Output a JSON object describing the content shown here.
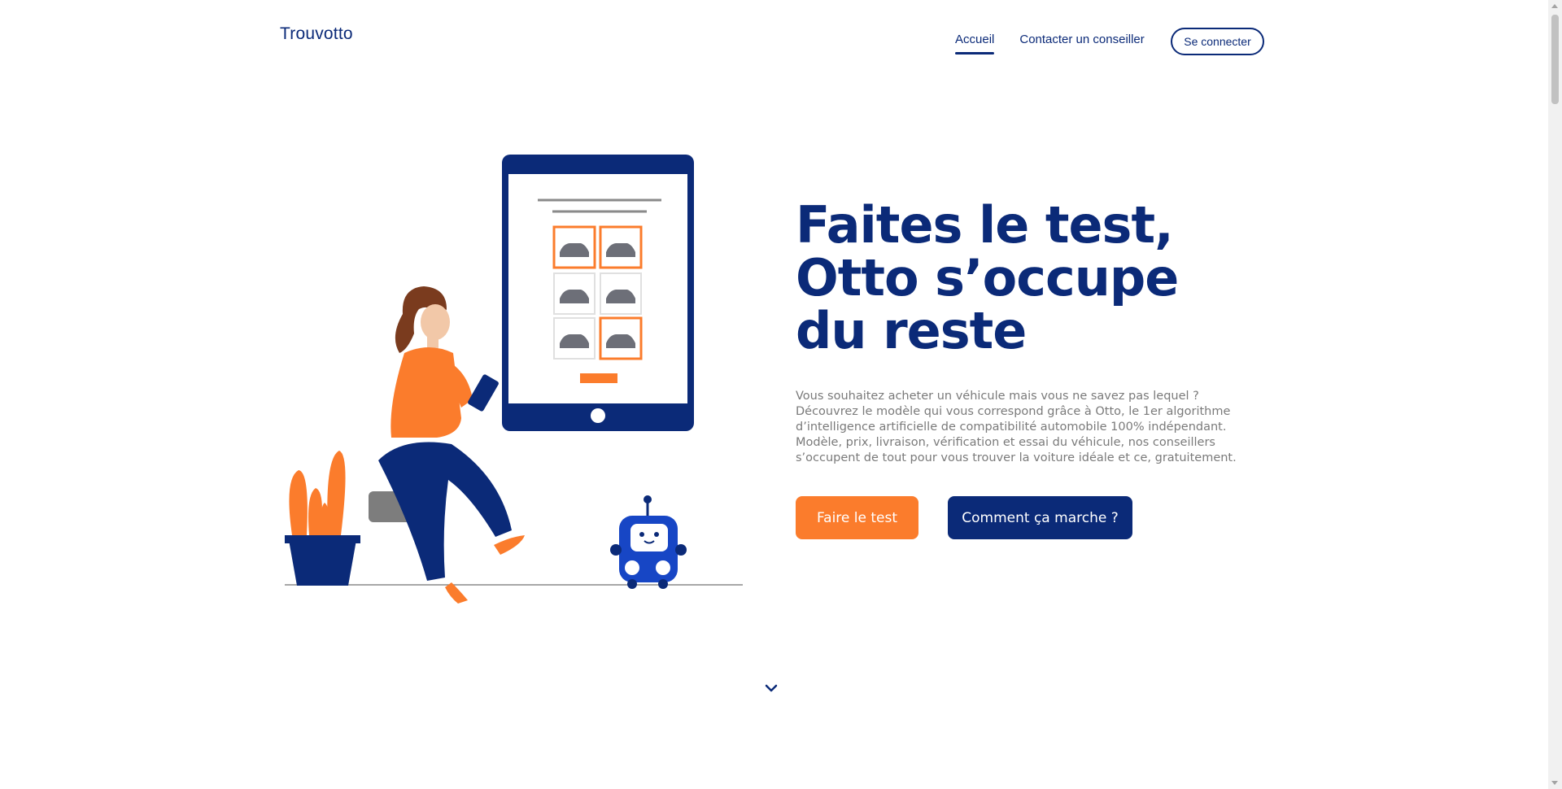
{
  "brand": {
    "name": "Trouvotto"
  },
  "nav": {
    "items": [
      {
        "label": "Accueil",
        "active": true
      },
      {
        "label": "Contacter un conseiller",
        "active": false
      }
    ],
    "login_label": "Se connecter"
  },
  "hero": {
    "title_line1": "Faites le test,",
    "title_line2": "Otto s’occupe",
    "title_line3": "du reste",
    "description": "Vous souhaitez acheter un véhicule mais vous ne savez pas lequel ? Découvrez le modèle qui vous correspond grâce à Otto, le 1er algorithme d’intelligence artificielle de compatibilité automobile 100% indépendant. Modèle, prix, livraison, vérification et essai du véhicule, nos conseillers s’occupent de tout pour vous trouver la voiture idéale et ce, gratuitement.",
    "primary_cta": "Faire le test",
    "secondary_cta": "Comment ça marche ?"
  },
  "icons": {
    "scroll": "chevron-down-icon"
  },
  "colors": {
    "brand_blue": "#0b2a78",
    "accent_orange": "#fb7c2c",
    "text_gray": "#7a7a7a"
  }
}
